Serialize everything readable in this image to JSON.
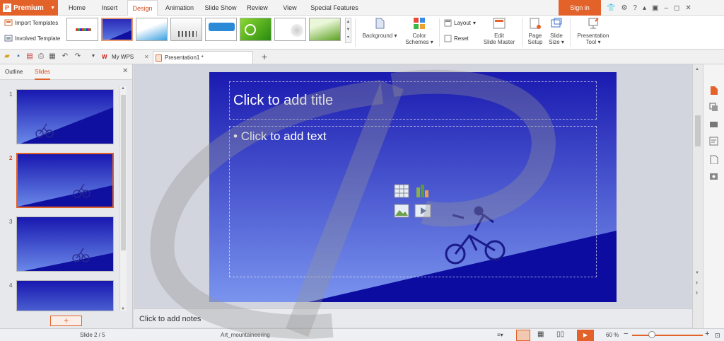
{
  "app": {
    "brand": "Premium"
  },
  "menu_tabs": [
    "Home",
    "Insert",
    "Design",
    "Animation",
    "Slide Show",
    "Review",
    "View",
    "Special Features"
  ],
  "active_tab": "Design",
  "account": {
    "signin_label": "Sign in"
  },
  "ribbon": {
    "import_templates": "Import Templates",
    "involved_template": "Involved Template",
    "background": "Background",
    "color_schemes_1": "Color",
    "color_schemes_2": "Schemes",
    "layout": "Layout",
    "reset": "Reset",
    "edit_master_1": "Edit",
    "edit_master_2": "Slide Master",
    "page_setup_1": "Page",
    "page_setup_2": "Setup",
    "slide_size_1": "Slide",
    "slide_size_2": "Size",
    "presentation_tool_1": "Presentation",
    "presentation_tool_2": "Tool"
  },
  "doc_tabs": {
    "mywps": "My WPS",
    "presentation": "Presentation1 *"
  },
  "panel": {
    "outline_tab": "Outline",
    "slides_tab": "Slides",
    "add_slide": "+"
  },
  "slides": [
    {
      "num": "1"
    },
    {
      "num": "2"
    },
    {
      "num": "3"
    },
    {
      "num": "4"
    }
  ],
  "slide": {
    "title_placeholder": "Click to add title",
    "text_placeholder": "Click to add text"
  },
  "notes_placeholder": "Click to add notes",
  "status": {
    "slide_counter": "Slide 2 / 5",
    "template_name": "Art_mountaineering",
    "zoom": "60 %"
  },
  "colors": {
    "accent": "#e2622a",
    "slide_dark": "#1010a8",
    "slide_light": "#6f86e8"
  }
}
